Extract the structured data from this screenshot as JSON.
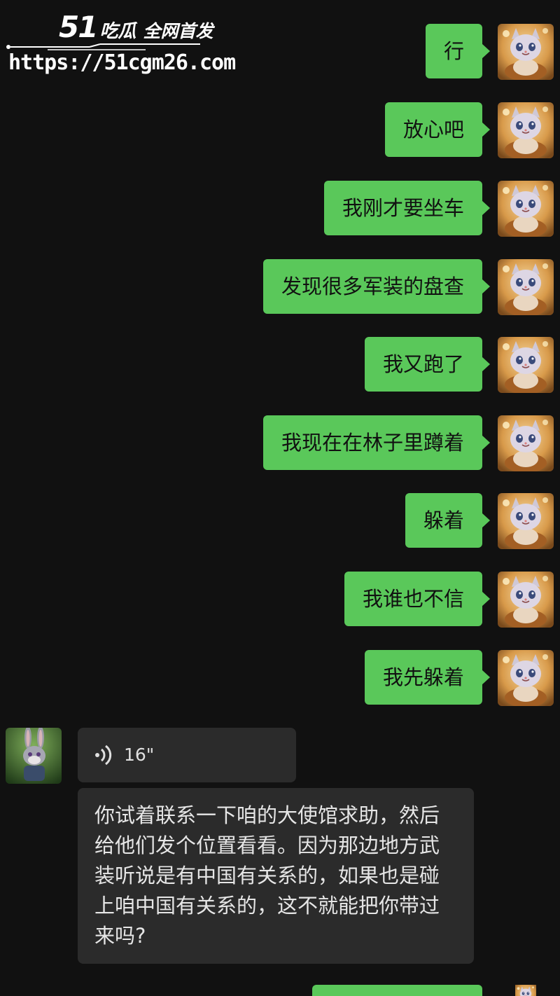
{
  "watermark": {
    "number": "51",
    "brand": "吃瓜",
    "slogan": "全网首发",
    "url": "https://51cgm26.com"
  },
  "messages_out": [
    {
      "text": "行"
    },
    {
      "text": "放心吧"
    },
    {
      "text": "我刚才要坐车"
    },
    {
      "text": "发现很多军装的盘查"
    },
    {
      "text": "我又跑了"
    },
    {
      "text": "我现在在林子里蹲着"
    },
    {
      "text": "躲着"
    },
    {
      "text": "我谁也不信"
    },
    {
      "text": "我先躲着"
    }
  ],
  "voice_message": {
    "duration": "16\"",
    "icon": "voice-wave-icon"
  },
  "incoming_text": "你试着联系一下咱的大使馆求助，然后给他们发个位置看看。因为那边地方武装听说是有中国有关系的，如果也是碰上咱中国有关系的，这不就能把你带过来吗?",
  "colors": {
    "background": "#111111",
    "outgoing_bubble": "#5ac85a",
    "incoming_bubble": "#2b2b2b"
  },
  "avatars": {
    "self": "cartoon-cat-avatar",
    "contact": "cartoon-rabbit-avatar"
  }
}
